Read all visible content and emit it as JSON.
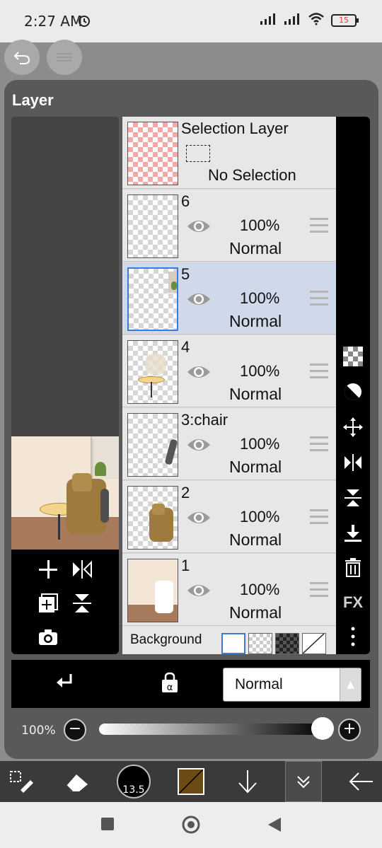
{
  "status": {
    "time": "2:27 AM",
    "battery": "15",
    "icons": [
      "alarm-icon",
      "signal-icon",
      "signal-icon",
      "wifi-icon",
      "battery-icon"
    ]
  },
  "panel": {
    "title": "Layer"
  },
  "layers": [
    {
      "name": "Selection Layer",
      "subtitle": "No Selection",
      "type": "selection"
    },
    {
      "name": "6",
      "opacity": "100%",
      "blend": "Normal"
    },
    {
      "name": "5",
      "opacity": "100%",
      "blend": "Normal",
      "selected": true
    },
    {
      "name": "4",
      "opacity": "100%",
      "blend": "Normal"
    },
    {
      "name": "3:chair",
      "opacity": "100%",
      "blend": "Normal"
    },
    {
      "name": "2",
      "opacity": "100%",
      "blend": "Normal"
    },
    {
      "name": "1",
      "opacity": "100%",
      "blend": "Normal"
    }
  ],
  "background": {
    "label": "Background"
  },
  "right_tools": {
    "fx_label": "FX"
  },
  "blend_mode": {
    "value": "Normal"
  },
  "opacity": {
    "label": "100%",
    "value": 100
  },
  "brush": {
    "size": "13.5"
  },
  "colors": {
    "primary": "#6b4a13",
    "accent": "#3a7bd5",
    "selected_row": "#cfd9ea"
  }
}
